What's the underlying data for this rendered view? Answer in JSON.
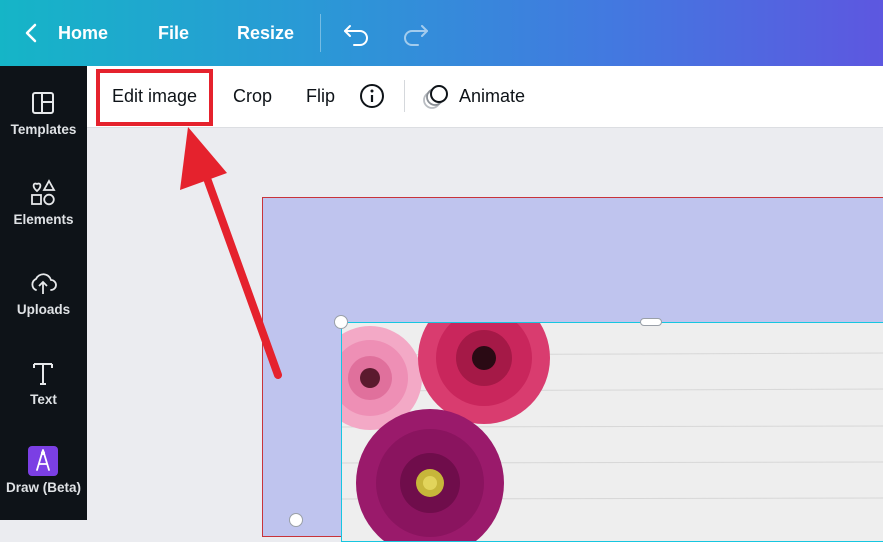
{
  "topbar": {
    "back_icon": "chevron-left-icon",
    "home_label": "Home",
    "file_label": "File",
    "resize_label": "Resize",
    "undo_icon": "undo-icon",
    "redo_icon": "redo-icon"
  },
  "sidebar": {
    "items": [
      {
        "label": "Templates",
        "icon": "templates-icon"
      },
      {
        "label": "Elements",
        "icon": "elements-icon"
      },
      {
        "label": "Uploads",
        "icon": "uploads-icon"
      },
      {
        "label": "Text",
        "icon": "text-icon"
      },
      {
        "label": "Draw (Beta)",
        "icon": "draw-icon"
      }
    ]
  },
  "toolbar": {
    "edit_image_label": "Edit image",
    "crop_label": "Crop",
    "flip_label": "Flip",
    "info_icon": "info-icon",
    "animate_icon": "animate-icon",
    "animate_label": "Animate"
  },
  "colors": {
    "topbar_gradient_start": "#15b5c7",
    "topbar_gradient_end": "#5d57e0",
    "sidebar_bg": "#0e1318",
    "page_bg": "#bfc4ee",
    "selection": "#16c6e0",
    "annotation_red": "#e5222d"
  }
}
